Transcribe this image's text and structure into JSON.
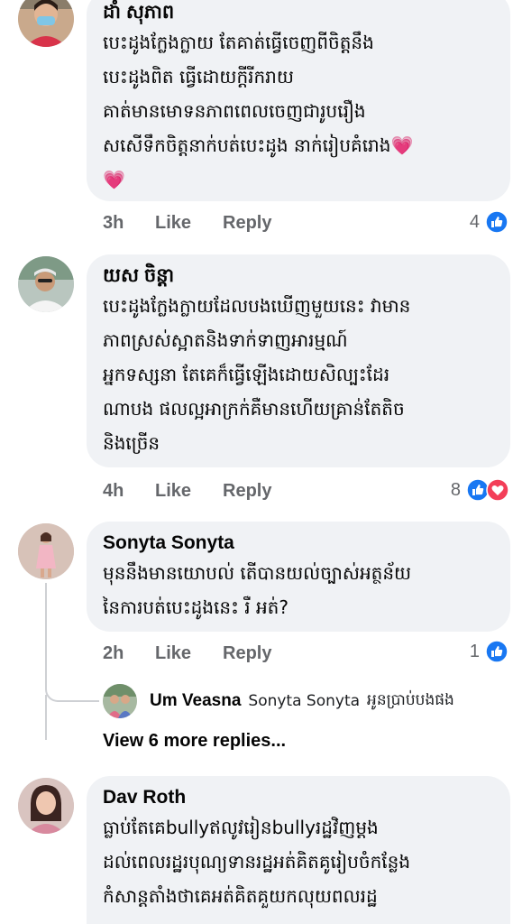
{
  "colors": {
    "bubble": "#f0f2f5",
    "meta": "#65676b",
    "like_blue": "#1877f2",
    "love_red": "#f33e58"
  },
  "comments": [
    {
      "author": "ដាំ សុភាព",
      "text": "បេះដូងក្លែងក្លាយ តែគាត់ធ្វើចេញពីចិត្តនឹង\nបេះដូងពិត ធ្វើដោយក្ដីរីករាយ\nគាត់មានមោទនភាពពេលចេញជារូបរឿង\nសសើទឹកចិត្តនាក់បត់បេះដូង នាក់រៀបគំរោង💗\n💗",
      "time": "3h",
      "like": "Like",
      "reply": "Reply",
      "reaction_count": "4",
      "reactions": [
        "like"
      ]
    },
    {
      "author": "យស ចិន្តា",
      "text": "បេះដូងក្លែងក្លាយដែលបងឃើញមួយនេះ វាមាន\nភាពស្រស់ស្អាតនិងទាក់ទាញអារម្មណ៍\nអ្នកទស្សនា តែគេក៏ធ្វើឡើងដោយសិល្បះដែរ\nណាបង ផលល្អអាក្រក់គឺមានហើយគ្រាន់តែតិច\nនិងច្រើន",
      "time": "4h",
      "like": "Like",
      "reply": "Reply",
      "reaction_count": "8",
      "reactions": [
        "like",
        "love"
      ]
    },
    {
      "author": "Sonyta Sonyta",
      "text": "មុននឹងមានយោបល់ តើបានយល់ច្បាស់អត្ថន័យ\nនៃការបត់បេះដូងនេះ រឺ អត់?",
      "time": "2h",
      "like": "Like",
      "reply": "Reply",
      "reaction_count": "1",
      "reactions": [
        "like"
      ],
      "reply_preview": {
        "author": "Um Veasna",
        "tag": "Sonyta Sonyta",
        "text": "អូនប្រាប់បងផង"
      },
      "more_replies": "View 6 more replies..."
    },
    {
      "author": "Dav Roth",
      "text": "ធ្លាប់តែគេbullyឥលូវរៀនbullyរដ្ឋវិញម្ដង\nដល់ពេលរដ្ឋរបុណ្យទានរដ្ឋអត់គិតគូរៀបចំកន្លែង\nកំសាន្តតាំងថាគេអត់គិតគួយកលុយពលរដ្ឋ"
    }
  ]
}
